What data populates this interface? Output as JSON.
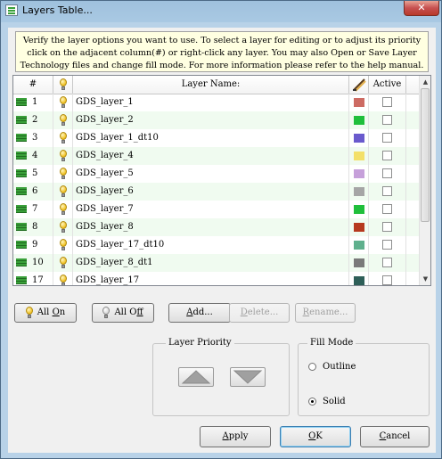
{
  "window": {
    "title": "Layers Table...",
    "close_label": "✕"
  },
  "info_text": [
    "Verify the layer options you want to use. To select a layer for editing or to adjust its priority",
    "click on the adjacent column(#) or right-click any layer.  You may also Open or Save Layer",
    "Technology files and change fill mode.  For more information please refer to the help manual."
  ],
  "table": {
    "headers": {
      "number": "#",
      "visibility_icon": "bulb-icon",
      "name": "Layer Name:",
      "color_icon": "pencil-icon",
      "active": "Active"
    },
    "rows": [
      {
        "number": "1",
        "name": "GDS_layer_1",
        "color": "#cd6b63",
        "active": false
      },
      {
        "number": "2",
        "name": "GDS_layer_2",
        "color": "#1fbf3b",
        "active": false
      },
      {
        "number": "3",
        "name": "GDS_layer_1_dt10",
        "color": "#6a5acd",
        "active": false
      },
      {
        "number": "4",
        "name": "GDS_layer_4",
        "color": "#f3e06a",
        "active": false
      },
      {
        "number": "5",
        "name": "GDS_layer_5",
        "color": "#c6a0da",
        "active": false
      },
      {
        "number": "6",
        "name": "GDS_layer_6",
        "color": "#a5a5a5",
        "active": false
      },
      {
        "number": "7",
        "name": "GDS_layer_7",
        "color": "#1fbf3b",
        "active": false
      },
      {
        "number": "8",
        "name": "GDS_layer_8",
        "color": "#b6391e",
        "active": false
      },
      {
        "number": "9",
        "name": "GDS_layer_17_dt10",
        "color": "#5fb08d",
        "active": false
      },
      {
        "number": "10",
        "name": "GDS_layer_8_dt1",
        "color": "#7a7a7a",
        "active": false
      },
      {
        "number": "17",
        "name": "GDS_layer_17",
        "color": "#2e5f58",
        "active": false
      }
    ]
  },
  "buttons": {
    "all_on": {
      "pre": "All ",
      "ul": "O",
      "post": "n"
    },
    "all_off": {
      "pre": "All O",
      "ul": "f",
      "post": "f"
    },
    "add": {
      "pre": "",
      "ul": "A",
      "post": "dd..."
    },
    "delete": {
      "pre": "",
      "ul": "D",
      "post": "elete..."
    },
    "rename": {
      "pre": "",
      "ul": "R",
      "post": "ename..."
    },
    "apply": {
      "pre": "",
      "ul": "A",
      "post": "pply"
    },
    "ok": {
      "pre": "",
      "ul": "O",
      "post": "K"
    },
    "cancel": {
      "pre": "",
      "ul": "C",
      "post": "ancel"
    }
  },
  "layer_priority": {
    "title": "Layer Priority",
    "up_icon": "arrow-up-icon",
    "down_icon": "arrow-down-icon"
  },
  "fill_mode": {
    "title": "Fill Mode",
    "outline": {
      "pre": "",
      "ul": "O",
      "post": "utline",
      "selected": false
    },
    "solid": {
      "pre": "",
      "ul": "S",
      "post": "olid",
      "selected": true
    }
  }
}
